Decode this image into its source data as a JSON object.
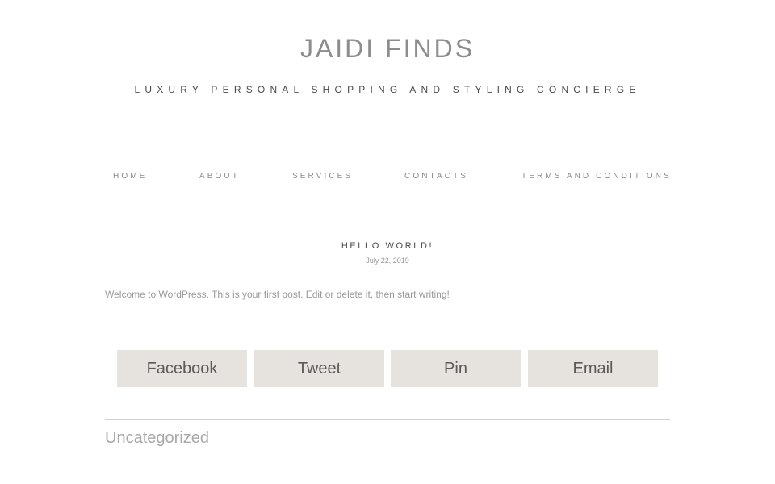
{
  "header": {
    "site_title": "JAIDI FINDS",
    "tagline": "LUXURY PERSONAL SHOPPING AND STYLING CONCIERGE"
  },
  "nav": {
    "items": [
      {
        "label": "HOME"
      },
      {
        "label": "ABOUT"
      },
      {
        "label": "SERVICES"
      },
      {
        "label": "CONTACTS"
      },
      {
        "label": "TERMS AND CONDITIONS"
      }
    ]
  },
  "post": {
    "title": "HELLO WORLD!",
    "date": "July 22, 2019",
    "body": "Welcome to WordPress. This is your first post. Edit or delete it, then start writing!"
  },
  "share": {
    "buttons": [
      {
        "label": "Facebook"
      },
      {
        "label": "Tweet"
      },
      {
        "label": "Pin"
      },
      {
        "label": "Email"
      }
    ]
  },
  "footer": {
    "category": "Uncategorized"
  },
  "colors": {
    "button_bg": "#e6e2de",
    "divider": "#cfcfcf"
  }
}
